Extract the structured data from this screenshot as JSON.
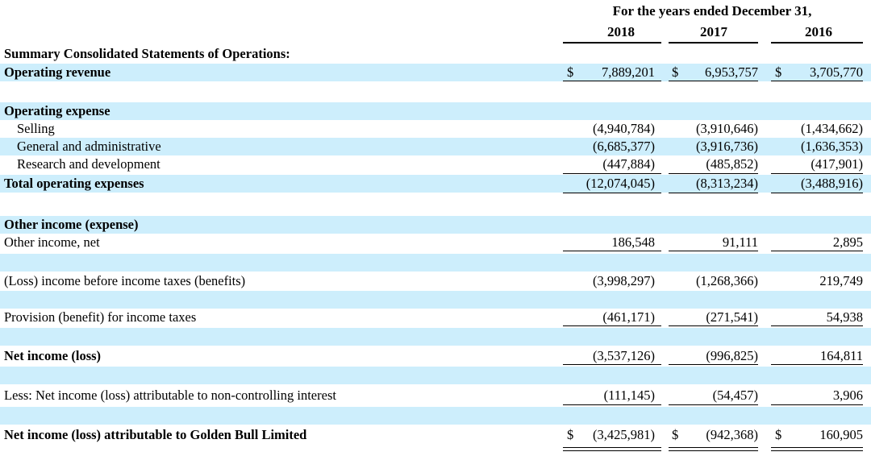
{
  "header": {
    "title": "For the years ended December 31,",
    "years": [
      "2018",
      "2017",
      "2016"
    ]
  },
  "rows": [
    {
      "label": "Summary Consolidated Statements of Operations:",
      "bold": true,
      "indent": false,
      "shaded": false,
      "currency": false,
      "values": [
        "",
        "",
        ""
      ]
    },
    {
      "label": "Operating revenue",
      "bold": true,
      "indent": false,
      "shaded": true,
      "currency": true,
      "values": [
        "7,889,201",
        "6,953,757",
        "3,705,770"
      ]
    },
    {
      "label": "",
      "bold": false,
      "indent": false,
      "shaded": false,
      "currency": false,
      "values": [
        "",
        "",
        ""
      ]
    },
    {
      "label": "Operating expense",
      "bold": true,
      "indent": false,
      "shaded": true,
      "currency": false,
      "values": [
        "",
        "",
        ""
      ]
    },
    {
      "label": "Selling",
      "bold": false,
      "indent": true,
      "shaded": false,
      "currency": false,
      "values": [
        "(4,940,784)",
        "(3,910,646)",
        "(1,434,662)"
      ]
    },
    {
      "label": "General and administrative",
      "bold": false,
      "indent": true,
      "shaded": true,
      "currency": false,
      "values": [
        "(6,685,377)",
        "(3,916,736)",
        "(1,636,353)"
      ]
    },
    {
      "label": "Research and development",
      "bold": false,
      "indent": true,
      "shaded": false,
      "currency": false,
      "values": [
        "(447,884)",
        "(485,852)",
        "(417,901)"
      ]
    },
    {
      "label": "Total operating expenses",
      "bold": true,
      "indent": false,
      "shaded": true,
      "currency": false,
      "values": [
        "(12,074,045)",
        "(8,313,234)",
        "(3,488,916)"
      ]
    },
    {
      "label": "",
      "bold": false,
      "indent": false,
      "shaded": false,
      "currency": false,
      "values": [
        "",
        "",
        ""
      ]
    },
    {
      "label": "Other income (expense)",
      "bold": true,
      "indent": false,
      "shaded": true,
      "currency": false,
      "values": [
        "",
        "",
        ""
      ]
    },
    {
      "label": "Other income, net",
      "bold": false,
      "indent": false,
      "shaded": false,
      "currency": false,
      "values": [
        "186,548",
        "91,111",
        "2,895"
      ]
    },
    {
      "label": "",
      "bold": false,
      "indent": false,
      "shaded": true,
      "currency": false,
      "values": [
        "",
        "",
        ""
      ]
    },
    {
      "label": "(Loss) income before income taxes (benefits)",
      "bold": false,
      "indent": false,
      "shaded": false,
      "currency": false,
      "values": [
        "(3,998,297)",
        "(1,268,366)",
        "219,749"
      ]
    },
    {
      "label": "",
      "bold": false,
      "indent": false,
      "shaded": true,
      "currency": false,
      "values": [
        "",
        "",
        ""
      ]
    },
    {
      "label": "Provision (benefit) for income taxes",
      "bold": false,
      "indent": false,
      "shaded": false,
      "currency": false,
      "values": [
        "(461,171)",
        "(271,541)",
        "54,938"
      ]
    },
    {
      "label": "",
      "bold": false,
      "indent": false,
      "shaded": true,
      "currency": false,
      "values": [
        "",
        "",
        ""
      ]
    },
    {
      "label": "Net income (loss)",
      "bold": true,
      "indent": false,
      "shaded": false,
      "currency": false,
      "values": [
        "(3,537,126)",
        "(996,825)",
        "164,811"
      ]
    },
    {
      "label": "",
      "bold": false,
      "indent": false,
      "shaded": true,
      "currency": false,
      "values": [
        "",
        "",
        ""
      ]
    },
    {
      "label": "Less: Net income (loss) attributable to non-controlling interest",
      "bold": false,
      "indent": false,
      "shaded": false,
      "currency": false,
      "values": [
        "(111,145)",
        "(54,457)",
        "3,906"
      ]
    },
    {
      "label": "",
      "bold": false,
      "indent": false,
      "shaded": true,
      "currency": false,
      "values": [
        "",
        "",
        ""
      ]
    },
    {
      "label": "Net income (loss) attributable to Golden Bull Limited",
      "bold": true,
      "indent": false,
      "shaded": false,
      "currency": true,
      "values": [
        "(3,425,981)",
        "(942,368)",
        "160,905"
      ]
    }
  ],
  "currency_symbol": "$",
  "colors": {
    "shade": "#cdeefc"
  }
}
